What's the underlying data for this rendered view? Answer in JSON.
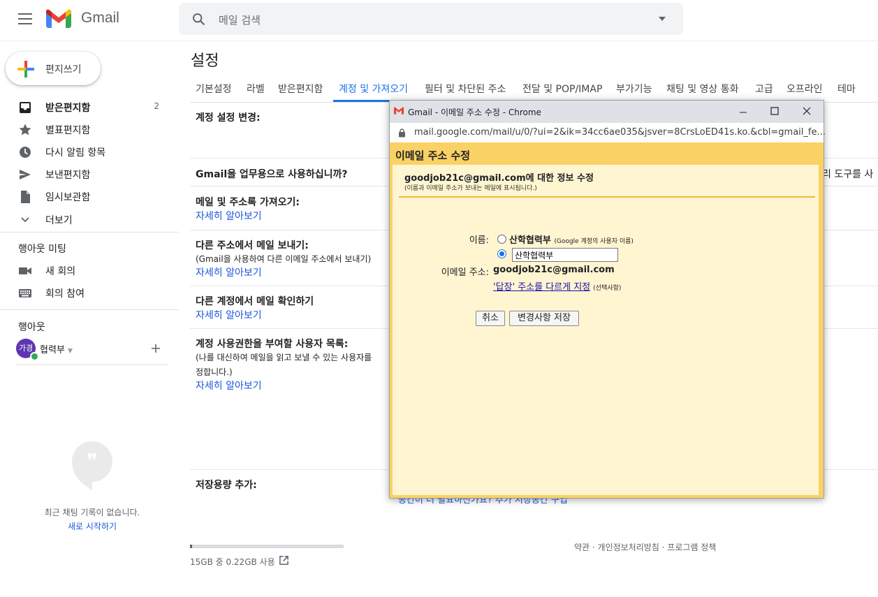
{
  "header": {
    "brand": "Gmail",
    "search_placeholder": "메일 검색"
  },
  "sidebar": {
    "compose_label": "편지쓰기",
    "items": [
      {
        "label": "받은편지함",
        "count": "2",
        "icon": "inbox-icon"
      },
      {
        "label": "별표편지함",
        "icon": "star-icon"
      },
      {
        "label": "다시 알림 항목",
        "icon": "clock-icon"
      },
      {
        "label": "보낸편지함",
        "icon": "send-icon"
      },
      {
        "label": "임시보관함",
        "icon": "draft-icon"
      },
      {
        "label": "더보기",
        "icon": "chevron-down-icon"
      }
    ],
    "meet_heading": "행아웃 미팅",
    "meet_items": [
      {
        "label": "새 회의",
        "icon": "video-icon"
      },
      {
        "label": "회의 참여",
        "icon": "keyboard-icon"
      }
    ],
    "hangouts_heading": "행아웃",
    "user": {
      "avatar_text": "가경",
      "name": "협력부"
    },
    "chat_empty": "최근 채팅 기록이 없습니다.",
    "chat_start": "새로 시작하기"
  },
  "main": {
    "title": "설정",
    "tabs": [
      "기본설정",
      "라벨",
      "받은편지함",
      "계정 및 가져오기",
      "필터 및 차단된 주소",
      "전달 및 POP/IMAP",
      "부가기능",
      "채팅 및 영상 통화",
      "고급",
      "오프라인",
      "테마"
    ],
    "sections": {
      "change_account": "계정 설정 변경:",
      "business": "Gmail을 업무용으로 사용하십니까?",
      "business_right": "리 도구를 사",
      "import": "메일 및 주소록 가져오기:",
      "send_as": "다른 주소에서 메일 보내기:",
      "send_as_sub": "(Gmail을 사용하여 다른 이메일 주소에서 보내기)",
      "check_mail": "다른 계정에서 메일 확인하기",
      "grant": "계정 사용권한을 부여할 사용자 목록:",
      "grant_sub1": "(나를 대신하여 메일을 읽고 보낼 수 있는 사용자를",
      "grant_sub2": "정합니다.)",
      "storage": "저장용량 추가:",
      "storage_right": "공간이 더 필요하신가요? 추가 저장공간 구입",
      "learn_more": "자세히 알아보기"
    },
    "footer": {
      "usage": "15GB 중 0.22GB 사용",
      "usage_fraction": 0.0147,
      "links": "약관 · 개인정보처리방침 · 프로그램 정책"
    }
  },
  "popup": {
    "window_title": "Gmail - 이메일 주소 수정 - Chrome",
    "url": "mail.google.com/mail/u/0/?ui=2&ik=34cc6ae035&jsver=8CrsLoED41s.ko.&cbl=gmail_fe...",
    "header": "이메일 주소 수정",
    "edit_title": "goodjob21c@gmail.com에 대한 정보 수정",
    "edit_sub": "(이름과 이메일 주소가 보내는 메일에 표시됩니다.)",
    "name_label": "이름:",
    "name_option1": "산학협력부",
    "name_option1_note": "(Google 계정의 사용자 이름)",
    "name_value": "산학협력부",
    "email_label": "이메일 주소:",
    "email_value": "goodjob21c@gmail.com",
    "reply_link": "'답장' 주소를 다르게 지정",
    "reply_note": "(선택사항)",
    "cancel": "취소",
    "save": "변경사항 저장",
    "colors": {
      "dialog_border": "#fad165",
      "dialog_body": "#fff6d1"
    }
  }
}
